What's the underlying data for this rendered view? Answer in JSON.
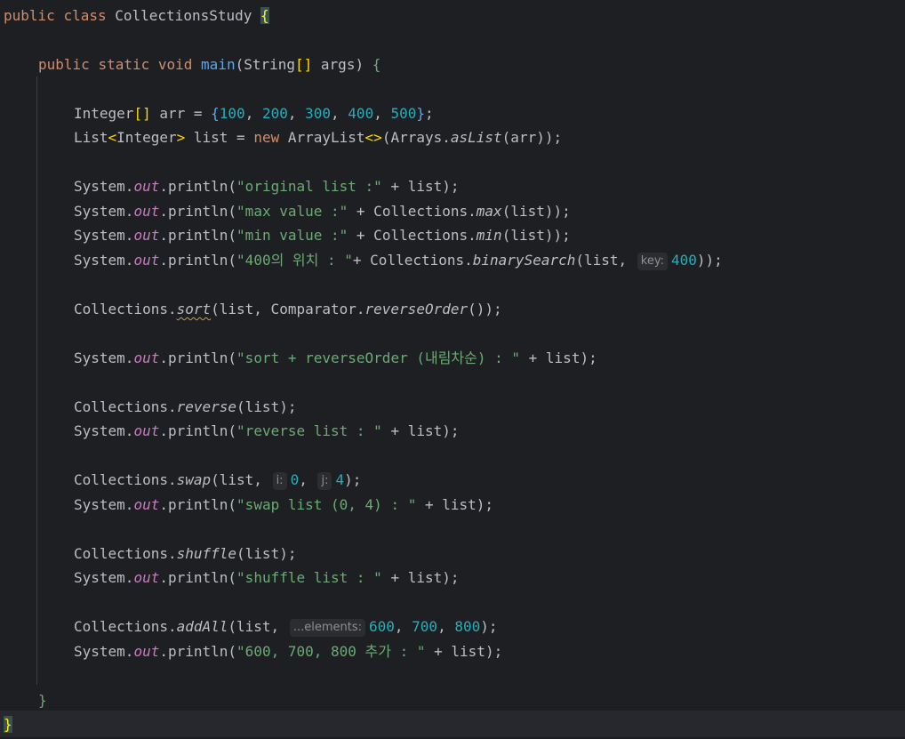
{
  "code": {
    "l0": {
      "kw1": "public",
      "kw2": "class",
      "name": "CollectionsStudy",
      "brace": "{"
    },
    "l1": {
      "kw1": "public",
      "kw2": "static",
      "kw3": "void",
      "fn": "main",
      "params_a": "(String",
      "params_b": "[]",
      "params_c": " args) ",
      "brace": "{"
    },
    "l2": {
      "t1": "Integer",
      "t2": "[]",
      "t3": " arr = ",
      "b1": "{",
      "n1": "100",
      "n2": "200",
      "n3": "300",
      "n4": "400",
      "n5": "500",
      "b2": "}",
      "end": ";"
    },
    "l3": {
      "t1": "List",
      "t2": "<",
      "t3": "Integer",
      "t4": ">",
      "t5": " list = ",
      "kw": "new",
      "t6": " ArrayList",
      "t7": "<>",
      "t8": "(Arrays.",
      "m": "asList",
      "t9": "(arr));"
    },
    "l4": {
      "sys": "System.",
      "out": "out",
      "p": ".println(",
      "s": "\"original list :\"",
      "rest": " + list);"
    },
    "l5": {
      "sys": "System.",
      "out": "out",
      "p": ".println(",
      "s": "\"max value :\"",
      "r1": " + Collections.",
      "m": "max",
      "r2": "(list));"
    },
    "l6": {
      "sys": "System.",
      "out": "out",
      "p": ".println(",
      "s": "\"min value :\"",
      "r1": " + Collections.",
      "m": "min",
      "r2": "(list));"
    },
    "l7": {
      "sys": "System.",
      "out": "out",
      "p": ".println(",
      "s": "\"400의 위치 : \"",
      "r1": "+ Collections.",
      "m": "binarySearch",
      "r2": "(list, ",
      "hint": "key:",
      "n": "400",
      "r3": "));"
    },
    "l8": {
      "t1": "Collections.",
      "m": "sort",
      "t2": "(list, Comparator.",
      "m2": "reverseOrder",
      "t3": "());"
    },
    "l9": {
      "sys": "System.",
      "out": "out",
      "p": ".println(",
      "s": "\"sort + reverseOrder (내림차순) : \"",
      "rest": " + list);"
    },
    "l10": {
      "t1": "Collections.",
      "m": "reverse",
      "t2": "(list);"
    },
    "l11": {
      "sys": "System.",
      "out": "out",
      "p": ".println(",
      "s": "\"reverse list : \"",
      "rest": " + list);"
    },
    "l12": {
      "t1": "Collections.",
      "m": "swap",
      "t2": "(list, ",
      "h1": "i:",
      "n1": "0",
      "c": ", ",
      "h2": "j:",
      "n2": "4",
      "t3": ");"
    },
    "l13": {
      "sys": "System.",
      "out": "out",
      "p": ".println(",
      "s": "\"swap list (0, 4) : \"",
      "rest": " + list);"
    },
    "l14": {
      "t1": "Collections.",
      "m": "shuffle",
      "t2": "(list);"
    },
    "l15": {
      "sys": "System.",
      "out": "out",
      "p": ".println(",
      "s": "\"shuffle list : \"",
      "rest": " + list);"
    },
    "l16": {
      "t1": "Collections.",
      "m": "addAll",
      "t2": "(list, ",
      "hint": "...elements:",
      "n1": "600",
      "n2": "700",
      "n3": "800",
      "t3": ");"
    },
    "l17": {
      "sys": "System.",
      "out": "out",
      "p": ".println(",
      "s": "\"600, 700, 800 추가 : \"",
      "rest": " + list);"
    },
    "l18": {
      "brace": "}"
    },
    "l19": {
      "brace": "}"
    }
  },
  "colors": {
    "background": "#1e1f22",
    "keyword": "#cf8e6d",
    "function": "#56a8f5",
    "number": "#2aacb8",
    "string": "#6aab73",
    "static_field": "#c77dbb"
  }
}
